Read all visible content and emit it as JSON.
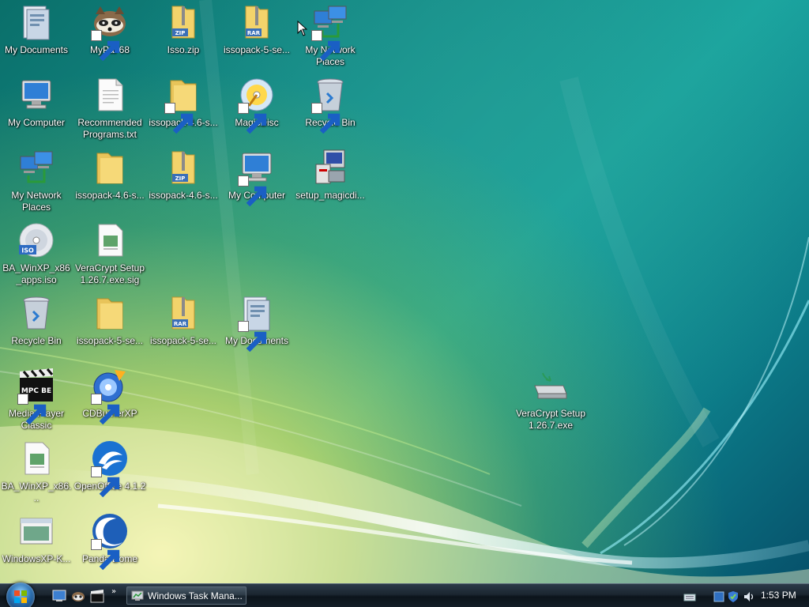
{
  "desktop": {
    "icons": [
      {
        "label": "My Documents",
        "icon": "my-documents-icon"
      },
      {
        "label": "MyPal 68",
        "icon": "mypal-raccoon-icon"
      },
      {
        "label": "Isso.zip",
        "icon": "zip-folder-icon",
        "badge": "ZIP"
      },
      {
        "label": "issopack-5-se...",
        "icon": "rar-folder-icon",
        "badge": "RAR"
      },
      {
        "label": "My Network Places",
        "icon": "network-places-icon"
      },
      {
        "label": "My Computer",
        "icon": "my-computer-icon"
      },
      {
        "label": "Recommended Programs.txt",
        "icon": "text-file-icon"
      },
      {
        "label": "issopack-4.6-s...",
        "icon": "folder-icon"
      },
      {
        "label": "MagicDisc",
        "icon": "magicdisc-icon"
      },
      {
        "label": "Recycle Bin",
        "icon": "recycle-bin-icon"
      },
      {
        "label": "My Network Places",
        "icon": "network-places-icon"
      },
      {
        "label": "issopack-4.6-s...",
        "icon": "folder-icon"
      },
      {
        "label": "issopack-4.6-s...",
        "icon": "zip-folder-icon",
        "badge": "ZIP"
      },
      {
        "label": "My Computer",
        "icon": "my-computer-icon"
      },
      {
        "label": "setup_magicdi...",
        "icon": "setup-installer-icon"
      },
      {
        "label": "BA_WinXP_x86_apps.iso",
        "icon": "iso-disc-icon",
        "badge": "ISO"
      },
      {
        "label": "VeraCrypt Setup 1.26.7.exe.sig",
        "icon": "document-file-icon"
      },
      {
        "label": "Recycle Bin",
        "icon": "recycle-bin-icon"
      },
      {
        "label": "issopack-5-se...",
        "icon": "folder-icon"
      },
      {
        "label": "issopack-5-se...",
        "icon": "rar-folder-icon",
        "badge": "RAR"
      },
      {
        "label": "My Documents",
        "icon": "my-documents-icon"
      },
      {
        "label": "Media Player Classic",
        "icon": "mpc-be-clapper-icon",
        "badge": "MPC BE"
      },
      {
        "label": "CDBurnerXP",
        "icon": "cdburnerxp-icon"
      },
      {
        "label": "BA_WinXP_x86...",
        "icon": "document-file-icon"
      },
      {
        "label": "OpenOffice 4.1.2",
        "icon": "openoffice-icon"
      },
      {
        "label": "WindowsXP-K...",
        "icon": "window-file-icon"
      },
      {
        "label": "Panda Dome",
        "icon": "panda-dome-icon"
      },
      {
        "label": "VeraCrypt Setup 1.26.7.exe",
        "icon": "veracrypt-drive-icon"
      }
    ]
  },
  "taskbar": {
    "start_icon": "windows-start-orb-icon",
    "quick_launch": [
      {
        "icon": "show-desktop-icon"
      },
      {
        "icon": "raccoon-browser-icon"
      },
      {
        "icon": "mpc-clapper-icon"
      }
    ],
    "more_glyph": "»",
    "task_button": {
      "label": "Windows Task Mana...",
      "icon": "task-manager-icon"
    },
    "tray": [
      {
        "icon": "keyboard-icon"
      },
      {
        "icon": "blue-square-icon"
      },
      {
        "icon": "shield-check-icon"
      },
      {
        "icon": "speaker-icon"
      }
    ],
    "clock": "1:53 PM"
  },
  "colors": {
    "wallpaper_teal": "#1ba6a0",
    "wallpaper_yellow": "#f3f0a0",
    "taskbar": "#1b2630",
    "folder": "#f3d36b"
  }
}
